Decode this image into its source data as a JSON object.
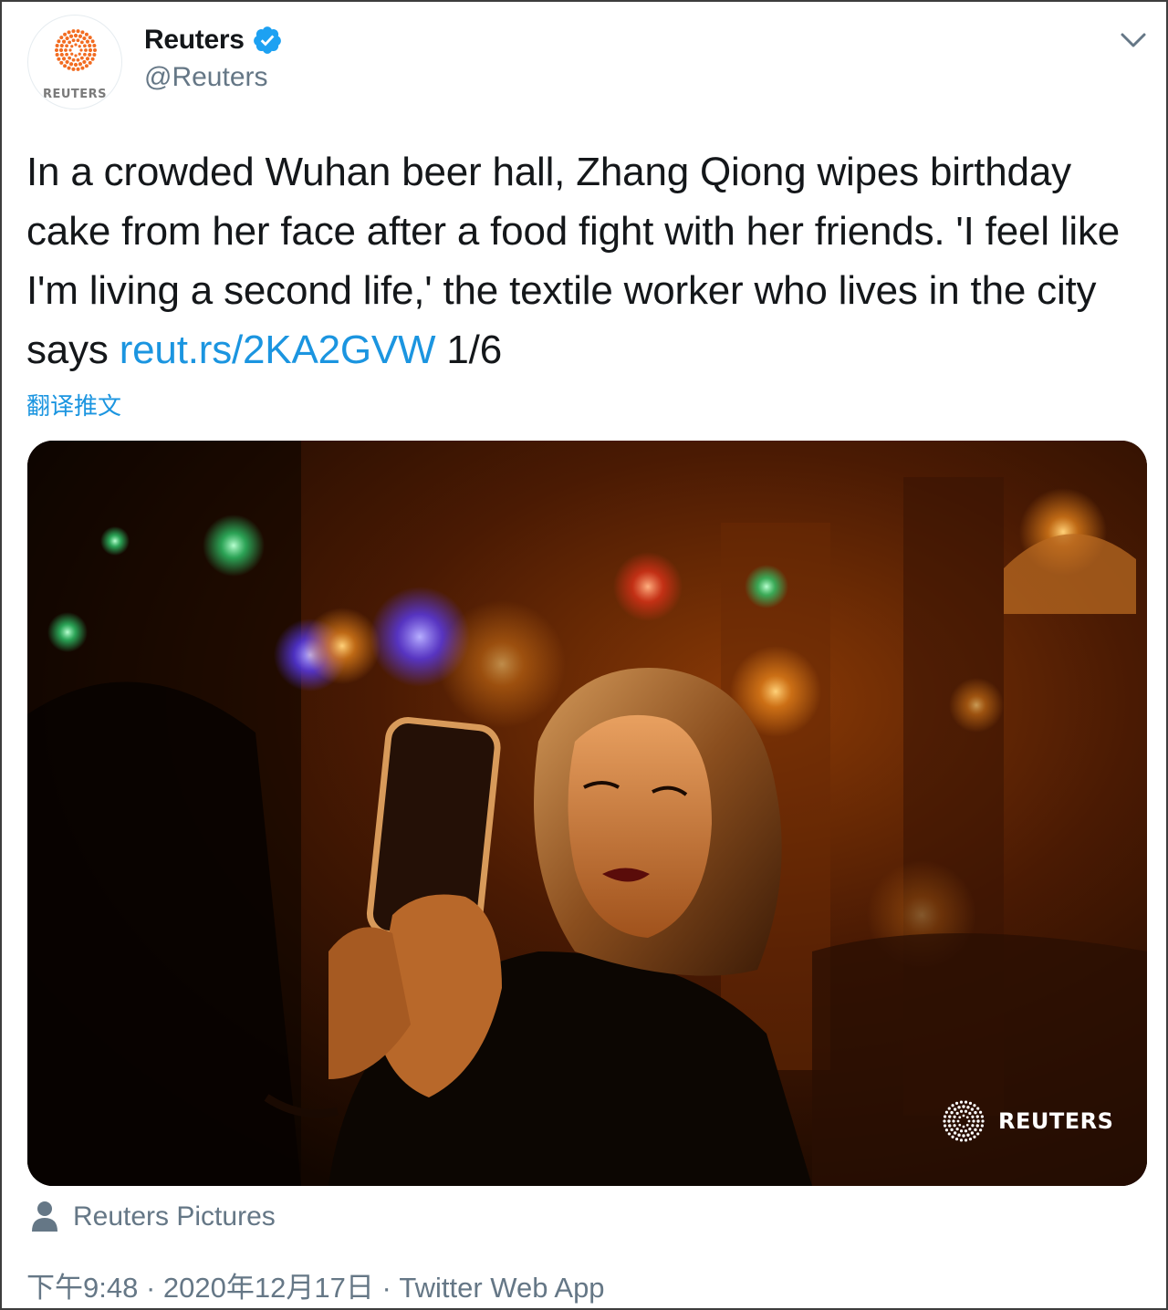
{
  "account": {
    "display_name": "Reuters",
    "handle": "@Reuters",
    "avatar_word": "REUTERS",
    "verified": true,
    "verified_color": "#1da1f2"
  },
  "tweet": {
    "text": "In a crowded Wuhan beer hall, Zhang Qiong wipes birthday cake from her face after a food fight with her friends. 'I feel like I'm living a second life,' the textile worker who lives in the city says ",
    "link": "reut.rs/2KA2GVW",
    "counter": " 1/6",
    "translate_label": "翻译推文",
    "link_color": "#1b95e0"
  },
  "media": {
    "watermark": "REUTERS",
    "brand_color": "#f26c21"
  },
  "tag": {
    "label": "Reuters Pictures"
  },
  "meta": {
    "time": "下午9:48",
    "date": "2020年12月17日",
    "source": "Twitter Web App",
    "separator": " · "
  },
  "icons": {
    "verified": "verified-badge-icon",
    "more": "chevron-down-icon",
    "tag": "person-icon",
    "logo": "reuters-logo-icon"
  }
}
